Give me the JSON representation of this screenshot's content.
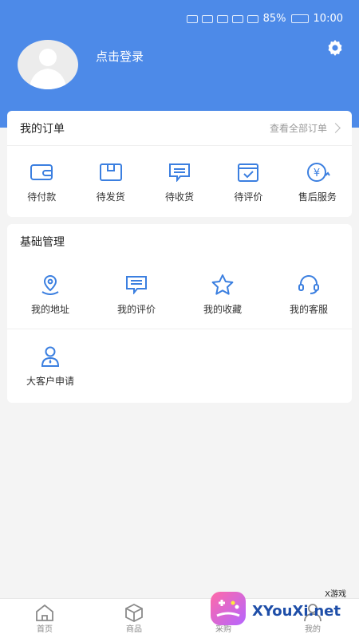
{
  "status_bar": {
    "battery_pct": "85%",
    "time": "10:00"
  },
  "header": {
    "login_text": "点击登录"
  },
  "orders": {
    "title": "我的订单",
    "view_all": "查看全部订单",
    "items": [
      {
        "label": "待付款"
      },
      {
        "label": "待发货"
      },
      {
        "label": "待收货"
      },
      {
        "label": "待评价"
      },
      {
        "label": "售后服务"
      }
    ]
  },
  "basic": {
    "title": "基础管理",
    "items": [
      {
        "label": "我的地址"
      },
      {
        "label": "我的评价"
      },
      {
        "label": "我的收藏"
      },
      {
        "label": "我的客服"
      }
    ],
    "extra": {
      "label": "大客户申请"
    }
  },
  "tabbar": {
    "tabs": [
      {
        "label": "首页"
      },
      {
        "label": "商品"
      },
      {
        "label": "采购"
      },
      {
        "label": "我的"
      }
    ]
  },
  "watermark": {
    "tag": "X游戏",
    "text": "XYouXi.net"
  },
  "colors": {
    "accent": "#4d8ae8",
    "icon_blue": "#3b7fe0"
  }
}
